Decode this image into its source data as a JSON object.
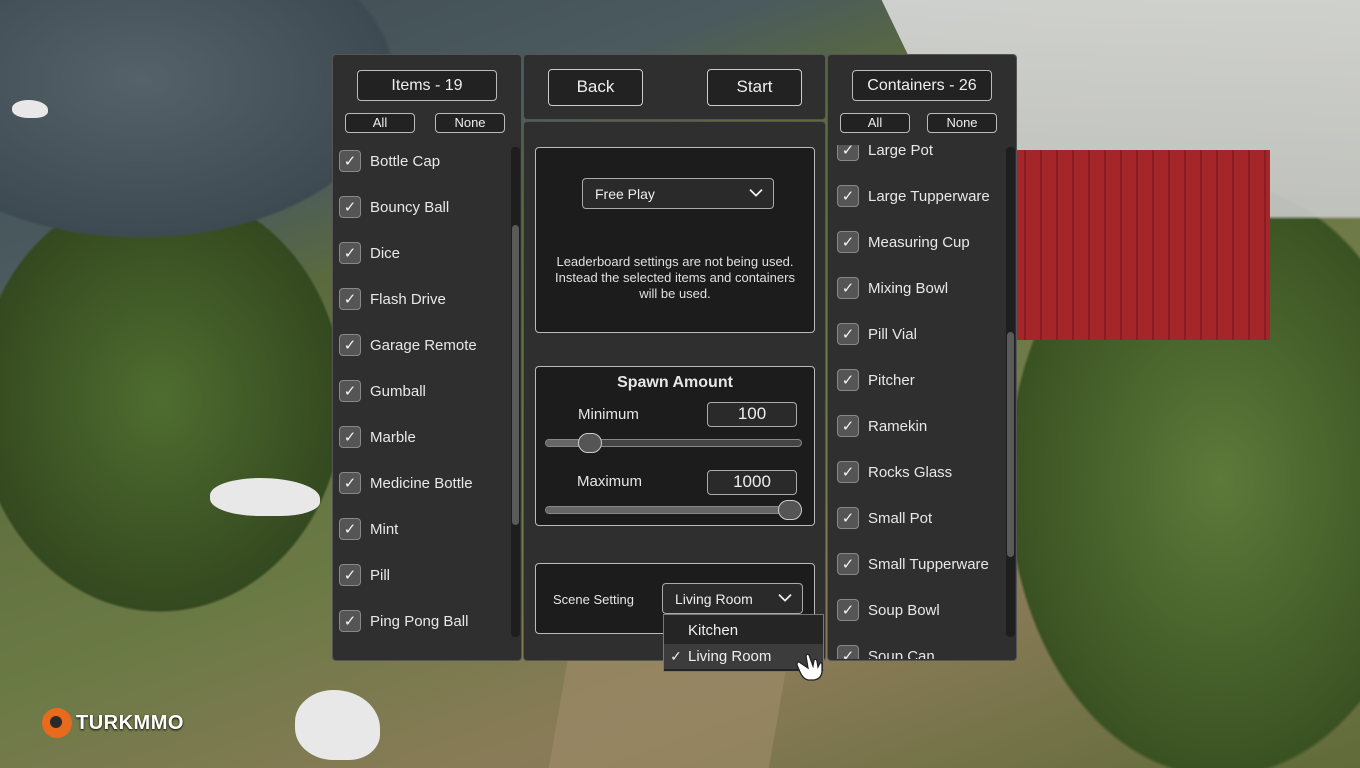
{
  "items_panel": {
    "title": "Items - 19",
    "all_label": "All",
    "none_label": "None",
    "items": [
      {
        "label": "Bottle Cap",
        "checked": true
      },
      {
        "label": "Bouncy Ball",
        "checked": true
      },
      {
        "label": "Dice",
        "checked": true
      },
      {
        "label": "Flash Drive",
        "checked": true
      },
      {
        "label": "Garage Remote",
        "checked": true
      },
      {
        "label": "Gumball",
        "checked": true
      },
      {
        "label": "Marble",
        "checked": true
      },
      {
        "label": "Medicine Bottle",
        "checked": true
      },
      {
        "label": "Mint",
        "checked": true
      },
      {
        "label": "Pill",
        "checked": true
      },
      {
        "label": "Ping Pong Ball",
        "checked": true
      }
    ]
  },
  "nav": {
    "back_label": "Back",
    "start_label": "Start"
  },
  "mode": {
    "selected": "Free Play",
    "info_text": "Leaderboard settings are not being used. Instead the selected items and containers will be used."
  },
  "spawn": {
    "title": "Spawn Amount",
    "min_label": "Minimum",
    "min_value": "100",
    "max_label": "Maximum",
    "max_value": "1000",
    "min_slider_fraction": 0.14,
    "max_slider_fraction": 1.0
  },
  "scene": {
    "label": "Scene Setting",
    "selected": "Living Room",
    "options": [
      {
        "label": "Kitchen",
        "selected": false
      },
      {
        "label": "Living Room",
        "selected": true
      }
    ],
    "check_mark": "✓"
  },
  "containers_panel": {
    "title": "Containers - 26",
    "all_label": "All",
    "none_label": "None",
    "items": [
      {
        "label": "Large Pot",
        "checked": true
      },
      {
        "label": "Large Tupperware",
        "checked": true
      },
      {
        "label": "Measuring Cup",
        "checked": true
      },
      {
        "label": "Mixing Bowl",
        "checked": true
      },
      {
        "label": "Pill Vial",
        "checked": true
      },
      {
        "label": "Pitcher",
        "checked": true
      },
      {
        "label": "Ramekin",
        "checked": true
      },
      {
        "label": "Rocks Glass",
        "checked": true
      },
      {
        "label": "Small Pot",
        "checked": true
      },
      {
        "label": "Small Tupperware",
        "checked": true
      },
      {
        "label": "Soup Bowl",
        "checked": true
      },
      {
        "label": "Soup Can",
        "checked": true
      }
    ]
  },
  "watermark": {
    "text": "TURKMMO"
  },
  "icons": {
    "checkbox": "check-icon",
    "dropdown": "chevron-down-icon",
    "cursor": "hand-cursor-icon"
  }
}
